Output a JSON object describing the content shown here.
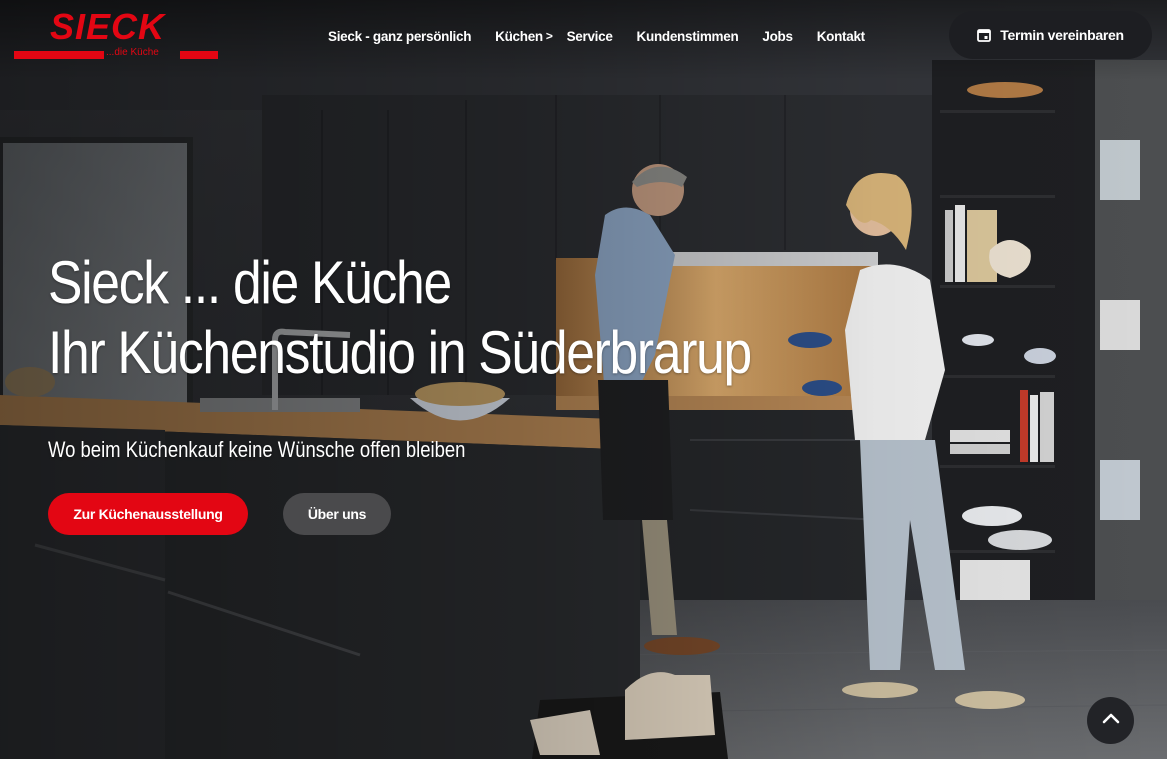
{
  "brand": {
    "logo_text": "SIECK",
    "tagline": "...die Küche",
    "color": "#e30613"
  },
  "nav": {
    "items": [
      {
        "label": "Sieck - ganz persönlich"
      },
      {
        "label": "Küchen",
        "chevron": ">"
      },
      {
        "label": "Service"
      },
      {
        "label": "Kundenstimmen"
      },
      {
        "label": "Jobs"
      },
      {
        "label": "Kontakt"
      }
    ]
  },
  "header_cta": {
    "label": "Termin vereinbaren",
    "icon": "calendar-icon"
  },
  "hero": {
    "title_line1": "Sieck ... die Küche",
    "title_line2": "Ihr Küchenstudio in Süderbrarup",
    "subtitle": "Wo beim Küchenkauf keine Wünsche offen bleiben",
    "primary_button": "Zur Küchenausstellung",
    "secondary_button": "Über uns",
    "image_alt": "kitchen-scene"
  },
  "scroll_top": {
    "icon": "chevron-up-icon"
  },
  "colors": {
    "accent": "#e30613",
    "dark_button": "#1d1e22",
    "secondary_button": "#4a4a4c"
  }
}
